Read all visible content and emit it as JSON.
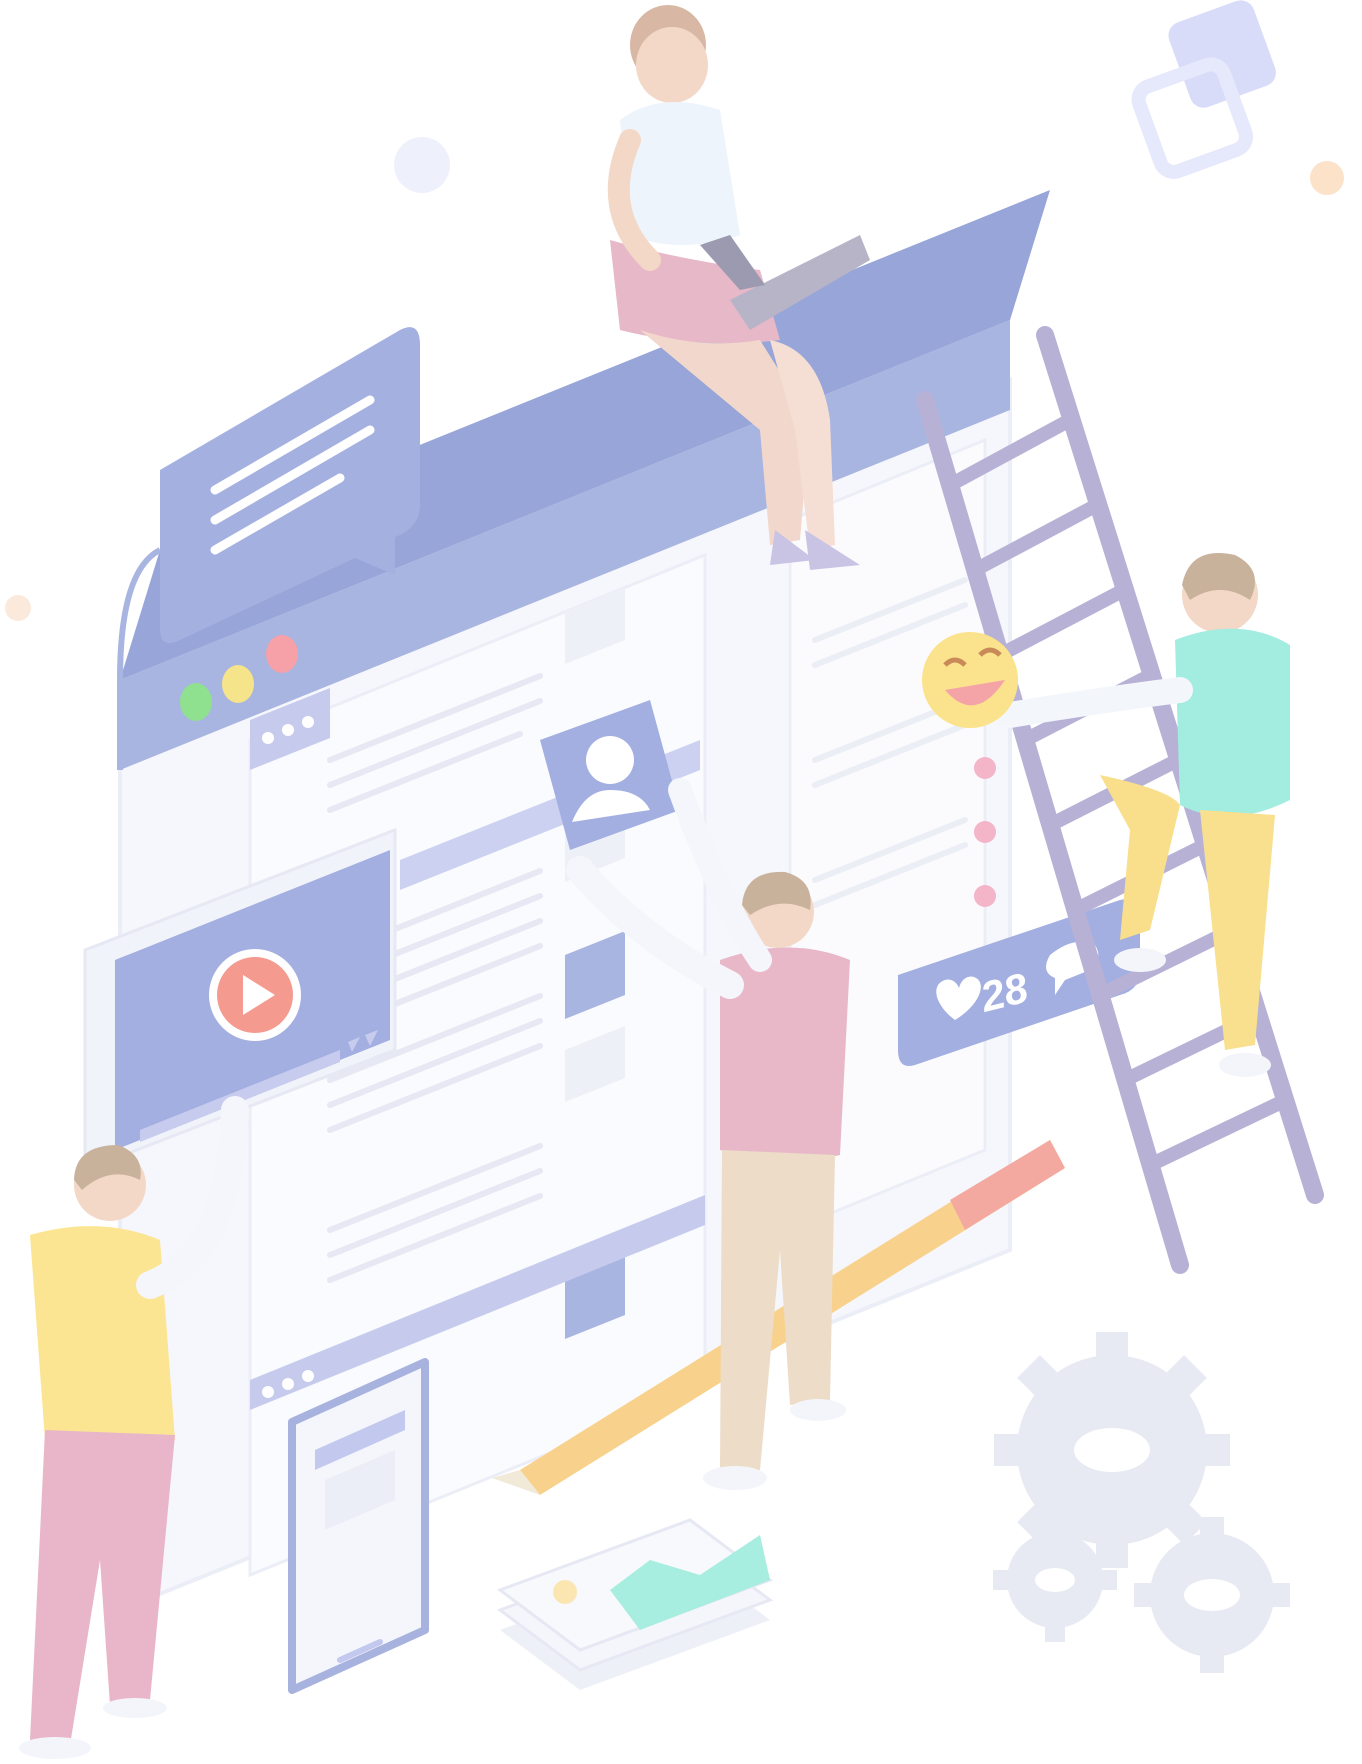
{
  "illustration": {
    "like_count": "28",
    "colors": {
      "primary": "#a8b4e0",
      "primary_dark": "#8e9ad0",
      "lavender": "#c9c6ef",
      "panel": "#f4f5fb",
      "line": "#e6e8f3",
      "play_red": "#f49a8f",
      "dot_green": "#8fe08f",
      "dot_yellow": "#f6e48a",
      "dot_red": "#f6a0a8",
      "pink": "#e7b6c8",
      "yellow": "#f8e08a",
      "teal": "#9eeadf",
      "tan": "#e7d3bd",
      "ladder": "#b7b1d6",
      "gear": "#e6e8f2"
    },
    "icons": [
      "chat-bubble-icon",
      "play-icon",
      "user-avatar-icon",
      "heart-icon",
      "comment-icon",
      "laughing-emoji-icon",
      "gear-icon"
    ]
  }
}
